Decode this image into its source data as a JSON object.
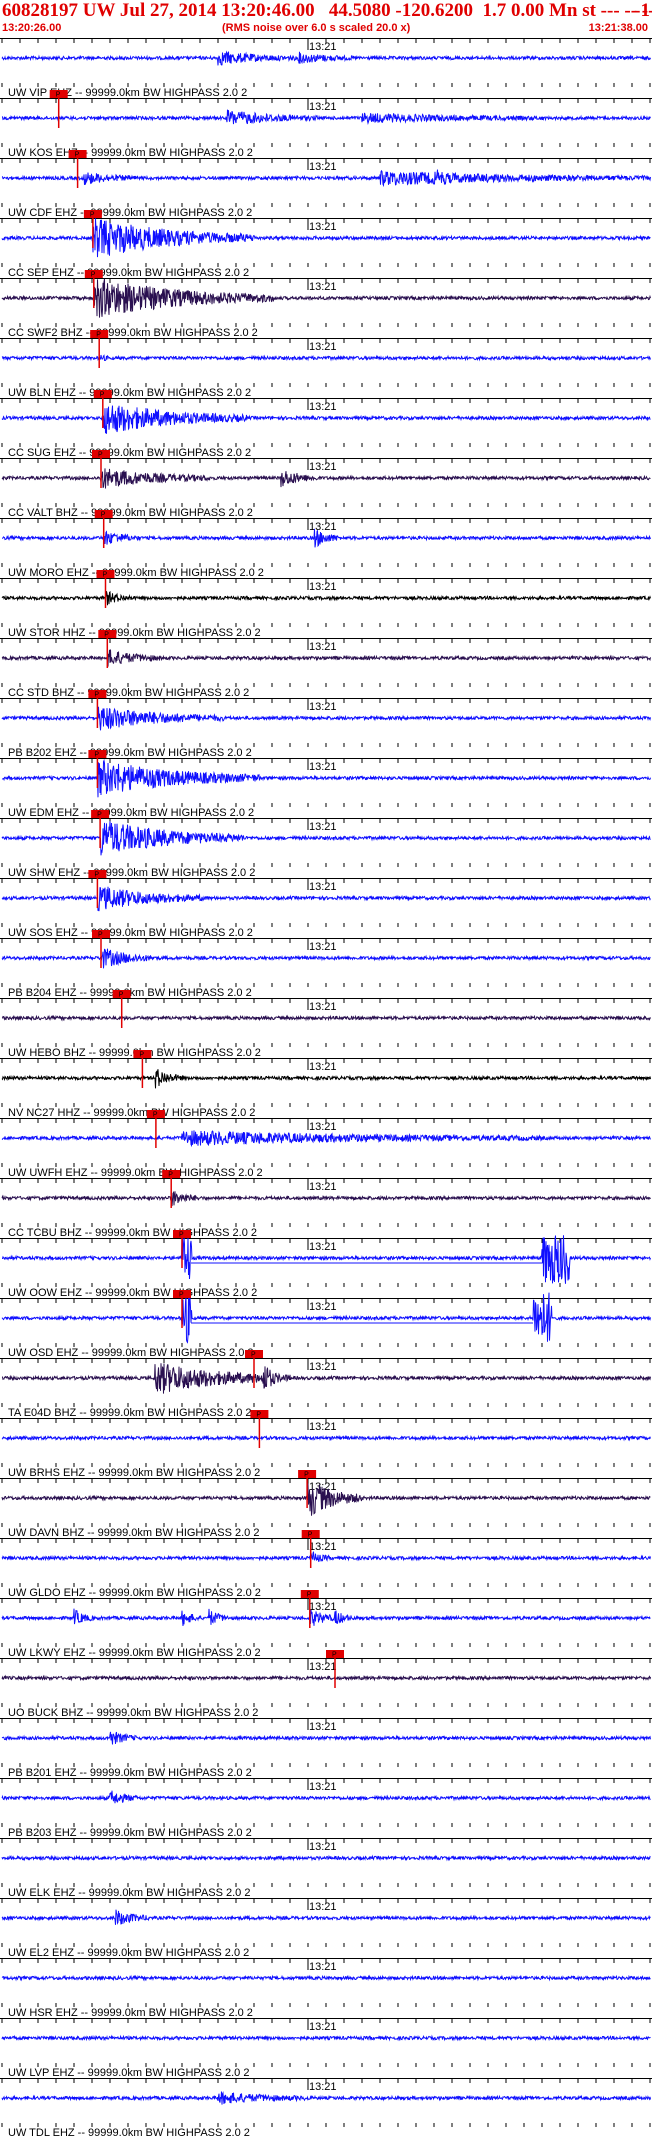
{
  "header": {
    "title": "60828197 UW Jul 27, 2014 13:20:46.00   44.5080 -120.6200  1.7 0.00 Mn st --- -- --",
    "title_right": "-1",
    "start_time": "13:20:26.00",
    "note": "(RMS noise over 6.0 s scaled 20.0 x)",
    "end_time": "13:21:38.00"
  },
  "colors": {
    "title": "#e00000",
    "trace_blue": "#1010ff",
    "trace_dark": "#2a1050",
    "trace_black": "#000000",
    "pick_box": "#e00000",
    "pick_line": "#e00000",
    "text": "#000000"
  },
  "chart_data": {
    "type": "line",
    "x_unit": "s",
    "x_range": [
      "13:20:26.00",
      "13:21:38.00"
    ],
    "minute_label": "13:21",
    "minute_mark_seconds": 34,
    "tick_interval_seconds": 2,
    "pick_label": "P",
    "traces": [
      {
        "label": "UW VIP EHZ -- 99999.0km BW  HIGHPASS  2.0  2",
        "color": "blue",
        "pick_s": null,
        "events": [
          [
            24,
            9,
            1.6
          ],
          [
            33,
            6,
            1.2
          ]
        ]
      },
      {
        "label": "UW KOS EHZ -- 99999.0km BW  HIGHPASS  2.0  2",
        "color": "blue",
        "pick_s": 6.3,
        "events": [
          [
            25,
            10,
            1.8
          ],
          [
            40,
            20,
            1.0
          ]
        ]
      },
      {
        "label": "UW CDF EHZ -- 99999.0km BW  HIGHPASS  2.0  2",
        "color": "blue",
        "pick_s": 8.4,
        "events": [
          [
            9,
            6,
            1.5
          ],
          [
            42,
            30,
            1.6
          ],
          [
            48,
            5,
            2.0
          ]
        ]
      },
      {
        "label": "CC SEP EHZ -- 99999.0km BW  HIGHPASS  2.0  2",
        "color": "blue",
        "pick_s": 10.1,
        "events": [
          [
            10.1,
            18,
            5.0
          ]
        ]
      },
      {
        "label": "CC SWF2 BHZ -- 99999.0km BW  HIGHPASS  2.0  2",
        "color": "dark",
        "pick_s": 10.2,
        "events": [
          [
            10.2,
            20,
            5.0
          ]
        ]
      },
      {
        "label": "UW BLN EHZ -- 99999.0km BW  HIGHPASS  2.0  2",
        "color": "blue",
        "pick_s": 10.8,
        "events": [
          [
            10.8,
            1,
            1.0
          ]
        ]
      },
      {
        "label": "CC SUG EHZ -- 99999.0km BW  HIGHPASS  2.0  2",
        "color": "blue",
        "pick_s": 11.2,
        "events": [
          [
            11.2,
            16,
            4.0
          ]
        ]
      },
      {
        "label": "CC VALT BHZ -- 99999.0km BW  HIGHPASS  2.0  2",
        "color": "dark",
        "pick_s": 11.0,
        "events": [
          [
            11.0,
            12,
            2.5
          ],
          [
            31,
            4,
            2.2
          ]
        ]
      },
      {
        "label": "UW MORO EHZ -- 99999.0km BW  HIGHPASS  2.0  2",
        "color": "blue",
        "pick_s": 11.3,
        "events": [
          [
            11.3,
            4,
            1.8
          ],
          [
            34.5,
            3,
            2.6
          ]
        ]
      },
      {
        "label": "UW STOR HHZ -- 99999.0km BW  HIGHPASS  2.0  2",
        "color": "black",
        "pick_s": 11.5,
        "events": [
          [
            11.5,
            3,
            1.6
          ]
        ]
      },
      {
        "label": "CC STD BHZ -- 99999.0km BW  HIGHPASS  2.0  2",
        "color": "dark",
        "pick_s": 11.7,
        "events": [
          [
            11.7,
            6,
            2.0
          ]
        ]
      },
      {
        "label": "PB B202 EHZ -- 99999.0km BW  HIGHPASS  2.0  2",
        "color": "blue",
        "pick_s": 10.6,
        "events": [
          [
            10.6,
            14,
            3.0
          ]
        ]
      },
      {
        "label": "UW EDM EHZ -- 99999.0km BW  HIGHPASS  2.0  2",
        "color": "blue",
        "pick_s": 10.6,
        "events": [
          [
            10.6,
            18,
            4.5
          ]
        ]
      },
      {
        "label": "UW SHW EHZ -- 99999.0km BW  HIGHPASS  2.0  2",
        "color": "blue",
        "pick_s": 10.9,
        "events": [
          [
            10.9,
            16,
            4.5
          ]
        ]
      },
      {
        "label": "UW SOS EHZ -- 99999.0km BW  HIGHPASS  2.0  2",
        "color": "blue",
        "pick_s": 10.6,
        "events": [
          [
            10.6,
            12,
            3.0
          ]
        ]
      },
      {
        "label": "PB B204 EHZ -- 99999.0km BW  HIGHPASS  2.0  2",
        "color": "blue",
        "pick_s": 11.0,
        "events": [
          [
            11.0,
            6,
            2.5
          ]
        ]
      },
      {
        "label": "UW HEBO BHZ -- 99999.0km BW  HIGHPASS  2.0  2",
        "color": "dark",
        "pick_s": 13.3,
        "events": []
      },
      {
        "label": "NV NC27 HHZ -- 99999.0km BW  HIGHPASS  2.0  2",
        "color": "black",
        "pick_s": 15.6,
        "events": [
          [
            17,
            3,
            2.5
          ]
        ]
      },
      {
        "label": "UW UWFH EHZ -- 99999.0km BW  HIGHPASS  2.0  2",
        "color": "blue",
        "pick_s": 17.1,
        "events": [
          [
            20,
            40,
            1.7
          ]
        ]
      },
      {
        "label": "CC TCBU BHZ -- 99999.0km BW  HIGHPASS  2.0  2",
        "color": "dark",
        "pick_s": 18.8,
        "events": [
          [
            18.8,
            3,
            2.0
          ]
        ]
      },
      {
        "label": "UW OOW EHZ -- 99999.0km BW  HIGHPASS  2.0  2",
        "color": "blue",
        "pick_s": 20.0,
        "events": [],
        "clipped": [
          [
            20.0,
            21.0
          ],
          [
            60.0,
            63.0
          ]
        ]
      },
      {
        "label": "UW OSD EHZ -- 99999.0km BW  HIGHPASS  2.0  2",
        "color": "blue",
        "pick_s": 20.0,
        "events": [],
        "clipped": [
          [
            20.0,
            21.0
          ],
          [
            59.0,
            61.0
          ]
        ]
      },
      {
        "label": "TA E04D BHZ -- 99999.0km BW  HIGHPASS  2.0  2",
        "color": "dark",
        "pick_s": 28.0,
        "events": [
          [
            17,
            15,
            4.0
          ],
          [
            29,
            2,
            4.5
          ]
        ]
      },
      {
        "label": "UW BRHS EHZ -- 99999.0km BW  HIGHPASS  2.0  2",
        "color": "blue",
        "pick_s": 28.6,
        "events": []
      },
      {
        "label": "UW DAVN BHZ -- 99999.0km BW  HIGHPASS  2.0  2",
        "color": "dark",
        "pick_s": 33.9,
        "events": [
          [
            33.9,
            6,
            5.0
          ]
        ]
      },
      {
        "label": "UW GLDO EHZ -- 99999.0km BW  HIGHPASS  2.0  2",
        "color": "blue",
        "pick_s": 34.3,
        "events": [
          [
            34.3,
            2,
            1.6
          ]
        ]
      },
      {
        "label": "UW LKWY EHZ -- 99999.0km BW  HIGHPASS  2.0  2",
        "color": "blue",
        "pick_s": 34.2,
        "events": [
          [
            8,
            2,
            2.0
          ],
          [
            20,
            2,
            2.0
          ],
          [
            23,
            2,
            2.0
          ],
          [
            34.2,
            3,
            2.2
          ],
          [
            37,
            2,
            1.8
          ]
        ]
      },
      {
        "label": "UO BUCK BHZ -- 99999.0km BW  HIGHPASS  2.0  2",
        "color": "dark",
        "pick_s": 37.0,
        "events": []
      },
      {
        "label": "PB B201 EHZ -- 99999.0km BW  HIGHPASS  2.0  2",
        "color": "blue",
        "pick_s": null,
        "events": [
          [
            12,
            3,
            1.8
          ]
        ]
      },
      {
        "label": "PB B203 EHZ -- 99999.0km BW  HIGHPASS  2.0  2",
        "color": "blue",
        "pick_s": null,
        "events": [
          [
            12,
            3,
            1.8
          ]
        ]
      },
      {
        "label": "UW ELK EHZ -- 99999.0km BW  HIGHPASS  2.0  2",
        "color": "blue",
        "pick_s": null,
        "events": []
      },
      {
        "label": "UW EL2 EHZ -- 99999.0km BW  HIGHPASS  2.0  2",
        "color": "blue",
        "pick_s": null,
        "events": [
          [
            12.5,
            4,
            2.0
          ]
        ]
      },
      {
        "label": "UW HSR EHZ -- 99999.0km BW  HIGHPASS  2.0  2",
        "color": "blue",
        "pick_s": null,
        "events": []
      },
      {
        "label": "UW LVP EHZ -- 99999.0km BW  HIGHPASS  2.0  2",
        "color": "blue",
        "pick_s": null,
        "events": []
      },
      {
        "label": "UW TDL EHZ -- 99999.0km BW  HIGHPASS  2.0  2",
        "color": "blue",
        "pick_s": null,
        "events": [
          [
            24,
            10,
            1.4
          ]
        ]
      }
    ]
  }
}
